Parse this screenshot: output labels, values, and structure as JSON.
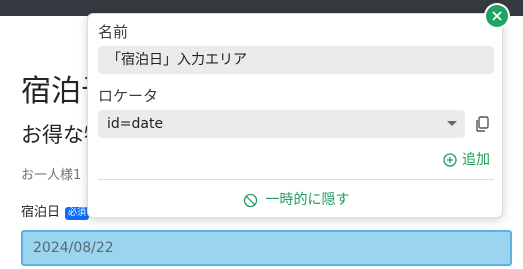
{
  "page": {
    "title": "宿泊予約",
    "subtitle": "お得な特典",
    "note": "お一人様1",
    "field_label": "宿泊日",
    "required_badge": "必須",
    "date_value": "2024/08/22"
  },
  "popover": {
    "name_label": "名前",
    "name_value": "「宿泊日」入力エリア",
    "locator_label": "ロケータ",
    "locator_value": "id=date",
    "add_label": "追加",
    "hide_label": "一時的に隠す"
  },
  "colors": {
    "accent_green": "#1e9e5c",
    "input_highlight": "#9bd4ee",
    "badge_blue": "#0d6efd"
  },
  "icons": {
    "close": "close-icon",
    "copy": "copy-icon",
    "add": "plus-circle-icon",
    "hide": "eye-off-icon",
    "caret": "chevron-down-icon"
  }
}
